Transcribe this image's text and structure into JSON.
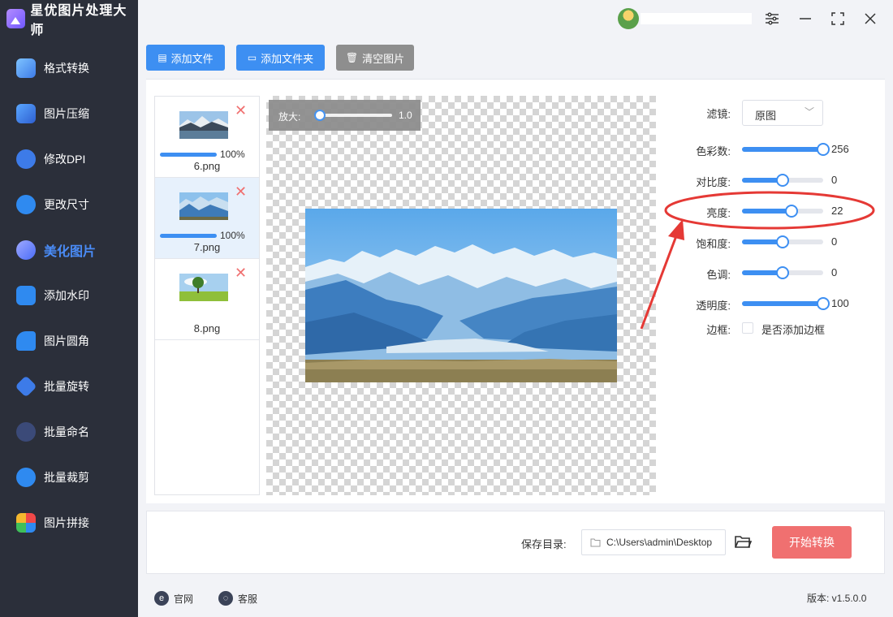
{
  "app": {
    "title": "星优图片处理大师"
  },
  "sidebar": {
    "items": [
      {
        "label": "格式转换",
        "icon": "format-convert-icon",
        "active": false
      },
      {
        "label": "图片压缩",
        "icon": "compress-icon",
        "active": false
      },
      {
        "label": "修改DPI",
        "icon": "dpi-icon",
        "active": false
      },
      {
        "label": "更改尺寸",
        "icon": "resize-icon",
        "active": false
      },
      {
        "label": "美化图片",
        "icon": "beautify-icon",
        "active": true
      },
      {
        "label": "添加水印",
        "icon": "watermark-icon",
        "active": false
      },
      {
        "label": "图片圆角",
        "icon": "rounded-corner-icon",
        "active": false
      },
      {
        "label": "批量旋转",
        "icon": "rotate-icon",
        "active": false
      },
      {
        "label": "批量命名",
        "icon": "rename-icon",
        "active": false
      },
      {
        "label": "批量裁剪",
        "icon": "crop-icon",
        "active": false
      },
      {
        "label": "图片拼接",
        "icon": "stitch-icon",
        "active": false
      }
    ]
  },
  "toolbar": {
    "add_file": "添加文件",
    "add_folder": "添加文件夹",
    "clear": "清空图片"
  },
  "files": [
    {
      "name": "6.png",
      "progress": "100%",
      "selected": false
    },
    {
      "name": "7.png",
      "progress": "100%",
      "selected": true
    },
    {
      "name": "8.png",
      "progress": "",
      "selected": false
    }
  ],
  "zoom": {
    "label": "放大:",
    "value": "1.0",
    "level": 0.0
  },
  "panel": {
    "filter": {
      "label": "滤镜:",
      "value": "原图"
    },
    "sliders": [
      {
        "label": "色彩数:",
        "value": "256",
        "fraction": 1.0
      },
      {
        "label": "对比度:",
        "value": "0",
        "fraction": 0.5
      },
      {
        "label": "亮度:",
        "value": "22",
        "fraction": 0.61
      },
      {
        "label": "饱和度:",
        "value": "0",
        "fraction": 0.5
      },
      {
        "label": "色调:",
        "value": "0",
        "fraction": 0.5
      },
      {
        "label": "透明度:",
        "value": "100",
        "fraction": 1.0
      }
    ],
    "border": {
      "label": "边框:",
      "option": "是否添加边框",
      "checked": false
    }
  },
  "save": {
    "label": "保存目录:",
    "path": "C:\\Users\\admin\\Desktop"
  },
  "start_button": "开始转换",
  "footer": {
    "website": "官网",
    "support": "客服",
    "version": "版本: v1.5.0.0"
  },
  "colors": {
    "accent": "#3d8ff2",
    "danger": "#f07070",
    "sidebar": "#2b2f3a",
    "annotation": "#e53935"
  }
}
